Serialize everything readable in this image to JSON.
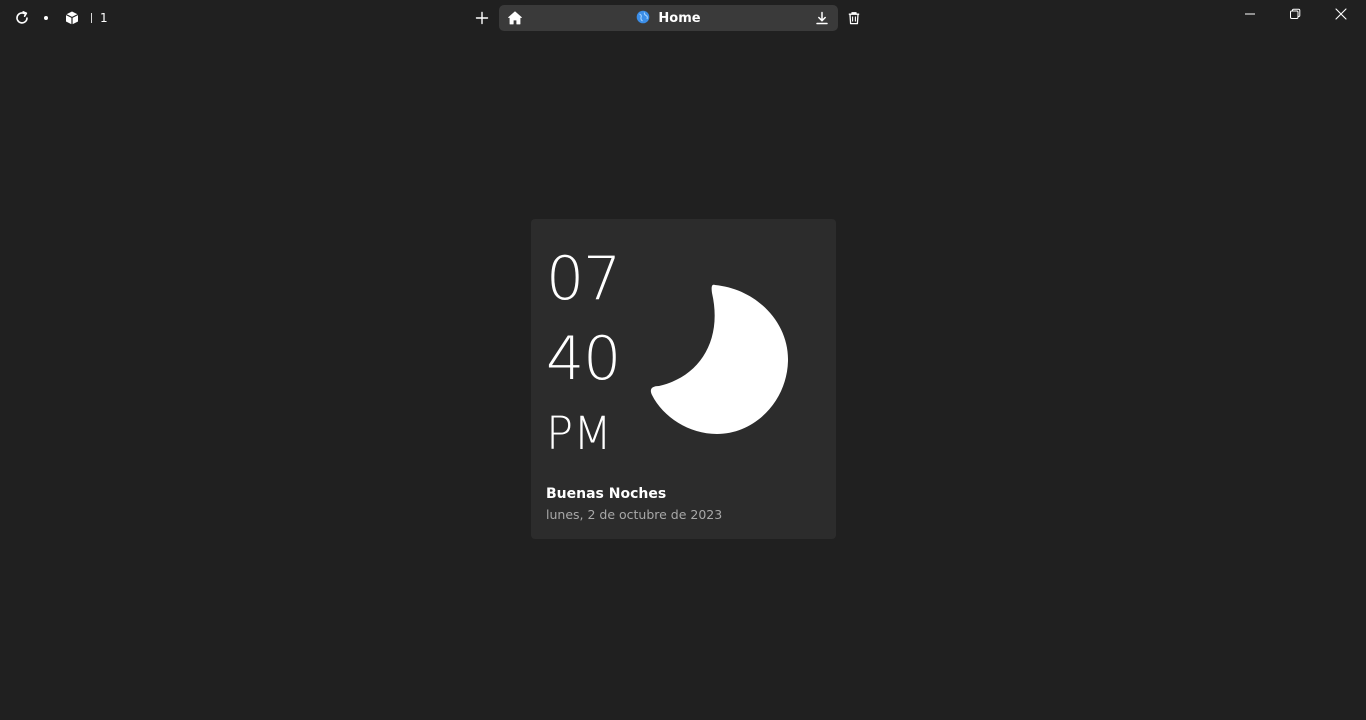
{
  "titlebar": {
    "tab_count": "1",
    "address": {
      "title": "Home"
    }
  },
  "widget": {
    "hours": "07",
    "minutes": "40",
    "period": "PM",
    "greeting": "Buenas Noches",
    "date": "lunes, 2 de octubre de 2023",
    "weather_icon": "moon-icon"
  },
  "icons": {
    "reload": "reload-icon",
    "extensions": "box-icon",
    "new_tab": "plus-icon",
    "home": "home-icon",
    "site": "globe-icon",
    "download": "download-icon",
    "delete": "trash-icon",
    "minimize": "minimize-icon",
    "maximize": "restore-icon",
    "close": "close-icon"
  },
  "colors": {
    "background": "#202020",
    "card": "#2c2c2c",
    "addressbar": "#3a3a3a",
    "globe": "#3b8ee8"
  }
}
